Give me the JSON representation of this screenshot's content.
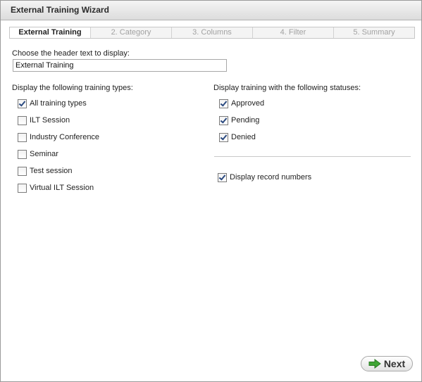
{
  "window": {
    "title": "External Training Wizard"
  },
  "steps": [
    {
      "label": "External Training",
      "active": true
    },
    {
      "label": "2. Category",
      "active": false
    },
    {
      "label": "3. Columns",
      "active": false
    },
    {
      "label": "4. Filter",
      "active": false
    },
    {
      "label": "5. Summary",
      "active": false
    }
  ],
  "header": {
    "prompt": "Choose the header text to display:",
    "value": "External Training"
  },
  "types": {
    "heading": "Display the following training types:",
    "items": [
      {
        "label": "All training types",
        "checked": true
      },
      {
        "label": "ILT Session",
        "checked": false
      },
      {
        "label": "Industry Conference",
        "checked": false
      },
      {
        "label": "Seminar",
        "checked": false
      },
      {
        "label": "Test session",
        "checked": false
      },
      {
        "label": "Virtual ILT Session",
        "checked": false
      }
    ]
  },
  "statuses": {
    "heading": "Display training with the following statuses:",
    "items": [
      {
        "label": "Approved",
        "checked": true
      },
      {
        "label": "Pending",
        "checked": true
      },
      {
        "label": "Denied",
        "checked": true
      }
    ]
  },
  "record_numbers": {
    "label": "Display record numbers",
    "checked": true
  },
  "footer": {
    "next_label": "Next",
    "next_icon": "green-right-arrow-icon"
  },
  "colors": {
    "accent_green": "#3fa535",
    "title_bg": "#e4e4e4"
  }
}
